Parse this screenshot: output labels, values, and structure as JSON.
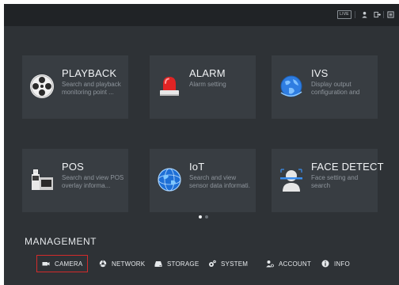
{
  "topbar": {
    "live_label": "LIVE",
    "icons": [
      "user-icon",
      "logout-icon",
      "menu-icon"
    ]
  },
  "tiles": [
    {
      "title": "PLAYBACK",
      "desc": "Search and playback monitoring point ...",
      "icon": "film-reel-icon"
    },
    {
      "title": "ALARM",
      "desc": "Alarm setting",
      "icon": "alarm-siren-icon"
    },
    {
      "title": "IVS",
      "desc": "Display output configuration and",
      "icon": "globe-icon"
    },
    {
      "title": "POS",
      "desc": "Search and view POS overlay informa...",
      "icon": "pos-terminal-icon"
    },
    {
      "title": "IoT",
      "desc": "Search and view sensor data informati.",
      "icon": "iot-globe-icon"
    },
    {
      "title": "FACE DETECT",
      "desc": "Face setting and search",
      "icon": "face-detect-icon"
    }
  ],
  "pager": {
    "active_page": 1,
    "total_pages": 2
  },
  "management": {
    "title": "MANAGEMENT",
    "items": [
      {
        "label": "CAMERA",
        "icon": "camera-icon",
        "selected": true
      },
      {
        "label": "NETWORK",
        "icon": "network-icon",
        "selected": false
      },
      {
        "label": "STORAGE",
        "icon": "storage-icon",
        "selected": false
      },
      {
        "label": "SYSTEM",
        "icon": "gear-icon",
        "selected": false
      },
      {
        "label": "ACCOUNT",
        "icon": "account-icon",
        "selected": false
      },
      {
        "label": "INFO",
        "icon": "info-icon",
        "selected": false
      }
    ]
  },
  "colors": {
    "background": "#2e3236",
    "topbar": "#202326",
    "tile": "#383d42",
    "selected_border": "#d22b2b"
  }
}
